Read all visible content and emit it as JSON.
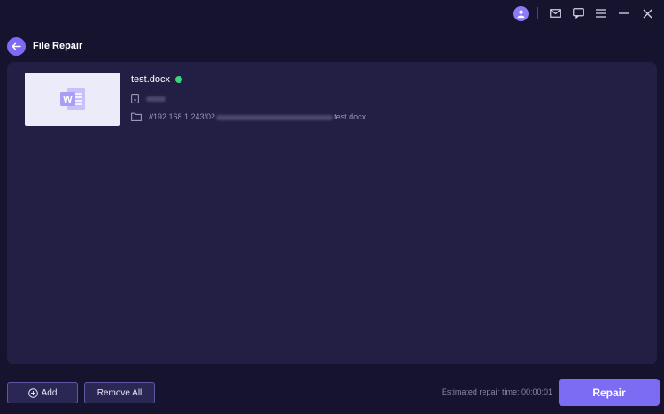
{
  "titlebar": {
    "icons": [
      "user-icon",
      "mail-icon",
      "feedback-icon",
      "menu-icon",
      "minimize-icon",
      "close-icon"
    ]
  },
  "header": {
    "title": "File Repair"
  },
  "file": {
    "name": "test.docx",
    "status_color": "#39d57a",
    "path_prefix": "//192.168.1.243/02",
    "path_suffix": "test.docx",
    "thumb_icon": "word-icon"
  },
  "footer": {
    "add_label": "Add",
    "remove_all_label": "Remove All",
    "estimate_label": "Estimated repair time: 00:00:01",
    "repair_label": "Repair"
  },
  "colors": {
    "accent": "#7c6cf4",
    "background": "#16132e",
    "panel": "#231f44",
    "success": "#39d57a"
  }
}
